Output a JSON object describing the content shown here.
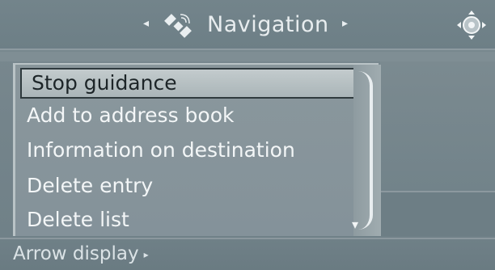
{
  "header": {
    "title": "Navigation",
    "prev_arrow": "◂",
    "next_arrow": "▸"
  },
  "menu": {
    "items": [
      {
        "label": "Stop guidance",
        "selected": true
      },
      {
        "label": "Add to address book",
        "selected": false
      },
      {
        "label": "Information on destination",
        "selected": false
      },
      {
        "label": "Delete entry",
        "selected": false
      },
      {
        "label": "Delete list",
        "selected": false
      }
    ],
    "scroll_down_glyph": "▾"
  },
  "bottom": {
    "label": "Arrow display",
    "arrow": "▸"
  },
  "icons": {
    "header_icon": "satellite-navigation-icon",
    "controller_icon": "controller-icon"
  },
  "colors": {
    "background": "#74848b",
    "menu": "#8a979c",
    "selected": "#b8c1c4",
    "text": "#f3f6f7"
  }
}
